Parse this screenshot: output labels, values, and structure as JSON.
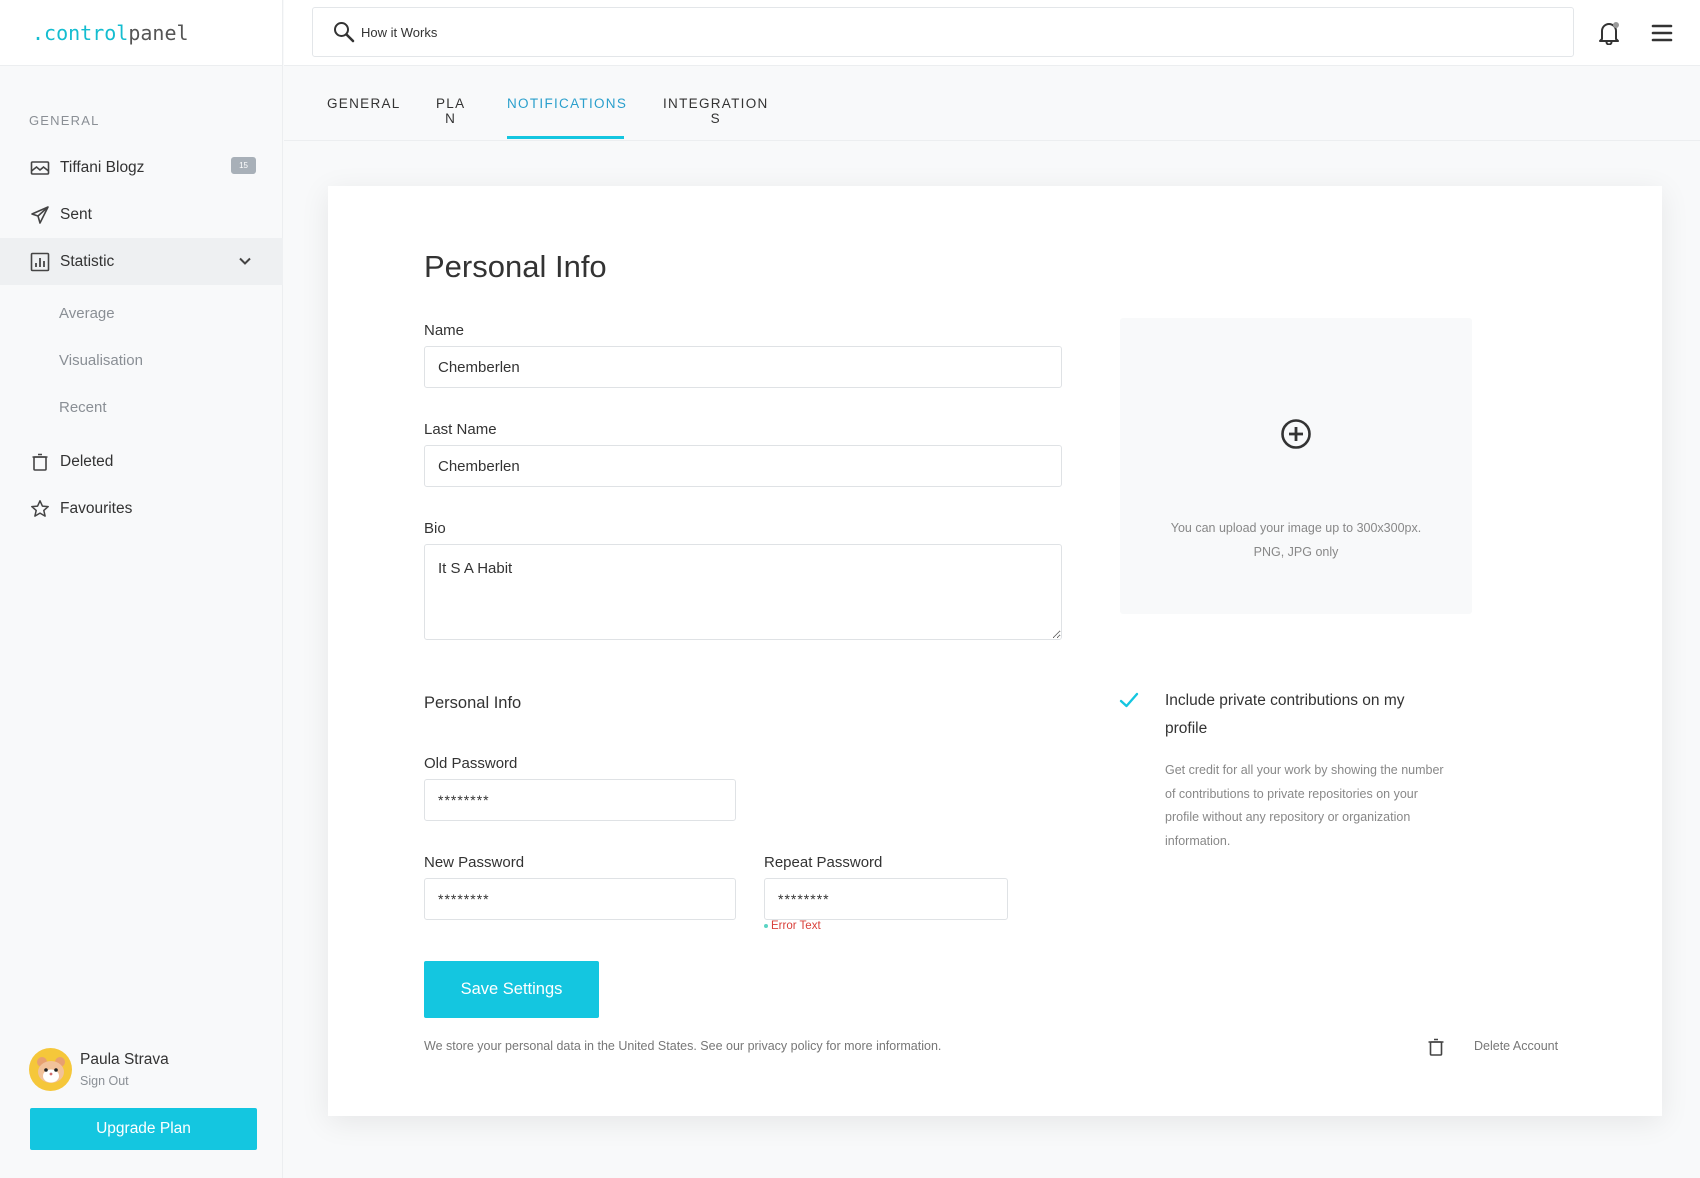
{
  "brand": {
    "dot": ".",
    "part1": "control",
    "part2": "panel"
  },
  "search": {
    "value": "How it Works"
  },
  "sidebar": {
    "section": "GENERAL",
    "items": [
      {
        "label": "Tiffani Blogz",
        "icon": "inbox-icon",
        "badge": "15"
      },
      {
        "label": "Sent",
        "icon": "paper-plane-icon"
      },
      {
        "label": "Statistic",
        "icon": "bar-chart-icon",
        "expanded": true
      },
      {
        "label": "Deleted",
        "icon": "trash-icon"
      },
      {
        "label": "Favourites",
        "icon": "star-icon"
      }
    ],
    "sub_items": [
      "Average",
      "Visualisation",
      "Recent"
    ],
    "user": {
      "name": "Paula Strava",
      "sign_out": "Sign Out"
    },
    "upgrade_label": "Upgrade Plan"
  },
  "tabs": [
    {
      "label": "GENERAL"
    },
    {
      "label": "PLA\nN"
    },
    {
      "label": "NOTIFICATIONS",
      "active": true
    },
    {
      "label": "INTEGRATION\nS"
    }
  ],
  "form": {
    "title": "Personal Info",
    "name": {
      "label": "Name",
      "value": "Chemberlen"
    },
    "last_name": {
      "label": "Last Name",
      "value": "Chemberlen"
    },
    "bio": {
      "label": "Bio",
      "value": "It S A Habit"
    },
    "section_title": "Personal Info",
    "old_password": {
      "label": "Old Password",
      "value": "********"
    },
    "new_password": {
      "label": "New Password",
      "value": "********"
    },
    "repeat_password": {
      "label": "Repeat Password",
      "value": "********",
      "error": "Error Text"
    },
    "save_label": "Save Settings",
    "privacy_note": "We store your personal data in the United States. See our privacy policy for more information."
  },
  "upload": {
    "text": "You can upload your image up to 300x300px. PNG, JPG only"
  },
  "private_contrib": {
    "checked": true,
    "title": "Include private contributions on my profile",
    "description": "Get credit for all your work by showing the number of contributions to private repositories on your profile without any repository or organization information."
  },
  "delete_account_label": "Delete Account",
  "colors": {
    "accent": "#14c6e0",
    "active_tab": "#2a9fcc",
    "error": "#d9403a"
  }
}
